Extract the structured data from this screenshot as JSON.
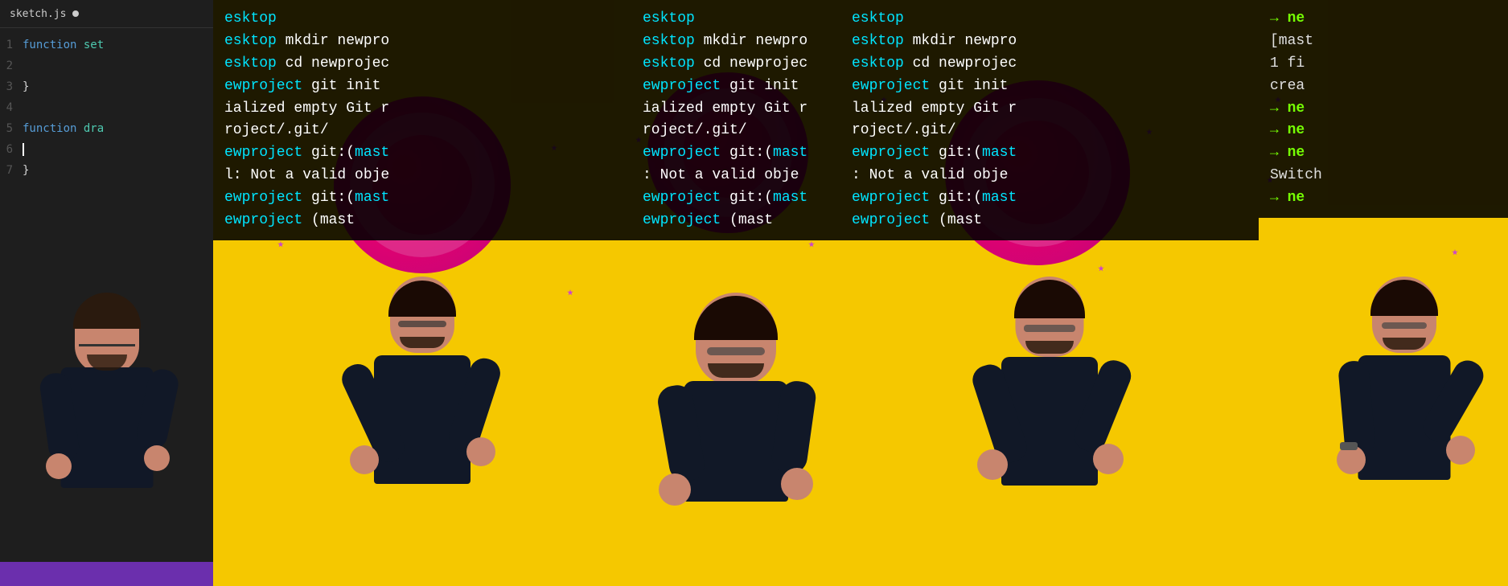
{
  "panels": {
    "editor": {
      "tab_name": "sketch.js",
      "tab_modified": true,
      "lines": [
        {
          "num": 1,
          "content": "function set",
          "type": "keyword_fn"
        },
        {
          "num": 2,
          "content": "",
          "type": "empty"
        },
        {
          "num": 3,
          "content": "}",
          "type": "brace"
        },
        {
          "num": 4,
          "content": "",
          "type": "empty"
        },
        {
          "num": 5,
          "content": "function dra",
          "type": "keyword_fn"
        },
        {
          "num": 6,
          "content": "",
          "type": "cursor"
        },
        {
          "num": 7,
          "content": "}",
          "type": "brace"
        }
      ],
      "bottom_bar_color": "#6b2fad"
    },
    "terminal_shared": {
      "lines_top": [
        {
          "text": "esktop",
          "color": "white"
        },
        {
          "text": "esktop mkdir newpro",
          "color": "mixed",
          "parts": [
            {
              "t": "esktop",
              "c": "cyan"
            },
            {
              "t": " mkdir newpro",
              "c": "white"
            }
          ]
        },
        {
          "text": "esktop cd newprojec",
          "color": "mixed",
          "parts": [
            {
              "t": "esktop",
              "c": "cyan"
            },
            {
              "t": " cd newprojec",
              "c": "white"
            }
          ]
        },
        {
          "text": "ewproject git init",
          "color": "mixed",
          "parts": [
            {
              "t": "ewproject",
              "c": "cyan"
            },
            {
              "t": " git init",
              "c": "white"
            }
          ]
        },
        {
          "text": "ialized empty Git r",
          "color": "white"
        },
        {
          "text": "roject/.git/",
          "color": "white"
        },
        {
          "text": "ewproject git:(mast",
          "color": "mixed",
          "parts": [
            {
              "t": "ewproject",
              "c": "cyan"
            },
            {
              "t": " git:(",
              "c": "white"
            },
            {
              "t": "mast",
              "c": "cyan"
            }
          ]
        },
        {
          "text": "l: Not a valid obje",
          "color": "white"
        },
        {
          "text": "ewproject git:(mast",
          "color": "mixed"
        },
        {
          "text": "ewproject   (mast",
          "color": "mixed"
        }
      ]
    },
    "panel_right": {
      "lines": [
        {
          "text": "→ ne",
          "color": "green"
        },
        {
          "text": "[mast",
          "color": "white"
        },
        {
          "text": " 1 fi",
          "color": "white"
        },
        {
          "text": "crea",
          "color": "white"
        },
        {
          "text": "→ ne",
          "color": "green"
        },
        {
          "text": "→ ne",
          "color": "green"
        },
        {
          "text": "→ ne",
          "color": "green"
        },
        {
          "text": "Switch",
          "color": "white"
        },
        {
          "text": "→ ne",
          "color": "green"
        }
      ]
    }
  },
  "decorations": {
    "stars_color": "#cc44cc",
    "circle_color": "#e0069a",
    "background_yellow": "#f5c800"
  }
}
